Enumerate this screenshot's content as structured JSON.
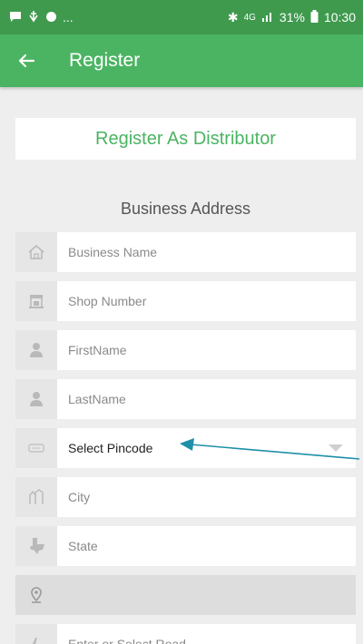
{
  "status_bar": {
    "left_icons": [
      "chat-icon",
      "usb-icon",
      "shield-icon"
    ],
    "overflow": "...",
    "bluetooth": "✱",
    "network": "4G",
    "signal": "📶",
    "battery_pct": "31%",
    "time": "10:30"
  },
  "app_bar": {
    "back_icon": "arrow-left-icon",
    "title": "Register"
  },
  "register_button": {
    "label": "Register As Distributor"
  },
  "section": {
    "title": "Business Address"
  },
  "fields": [
    {
      "icon": "house-icon",
      "label": "Business Name"
    },
    {
      "icon": "shop-icon",
      "label": "Shop Number"
    },
    {
      "icon": "person-icon",
      "label": "FirstName"
    },
    {
      "icon": "person-icon",
      "label": "LastName"
    },
    {
      "icon": "pincode-icon",
      "label": "Select Pincode"
    },
    {
      "icon": "city-icon",
      "label": "City"
    },
    {
      "icon": "state-icon",
      "label": "State"
    },
    {
      "icon": "location-pin-icon",
      "label": ""
    },
    {
      "icon": "road-icon",
      "label": "Enter or Select Road"
    }
  ],
  "colors": {
    "status_bar": "#3f9a4e",
    "app_bar": "#4bb462",
    "accent_text": "#4bb462",
    "annotation_arrow": "#1e8fa8"
  }
}
